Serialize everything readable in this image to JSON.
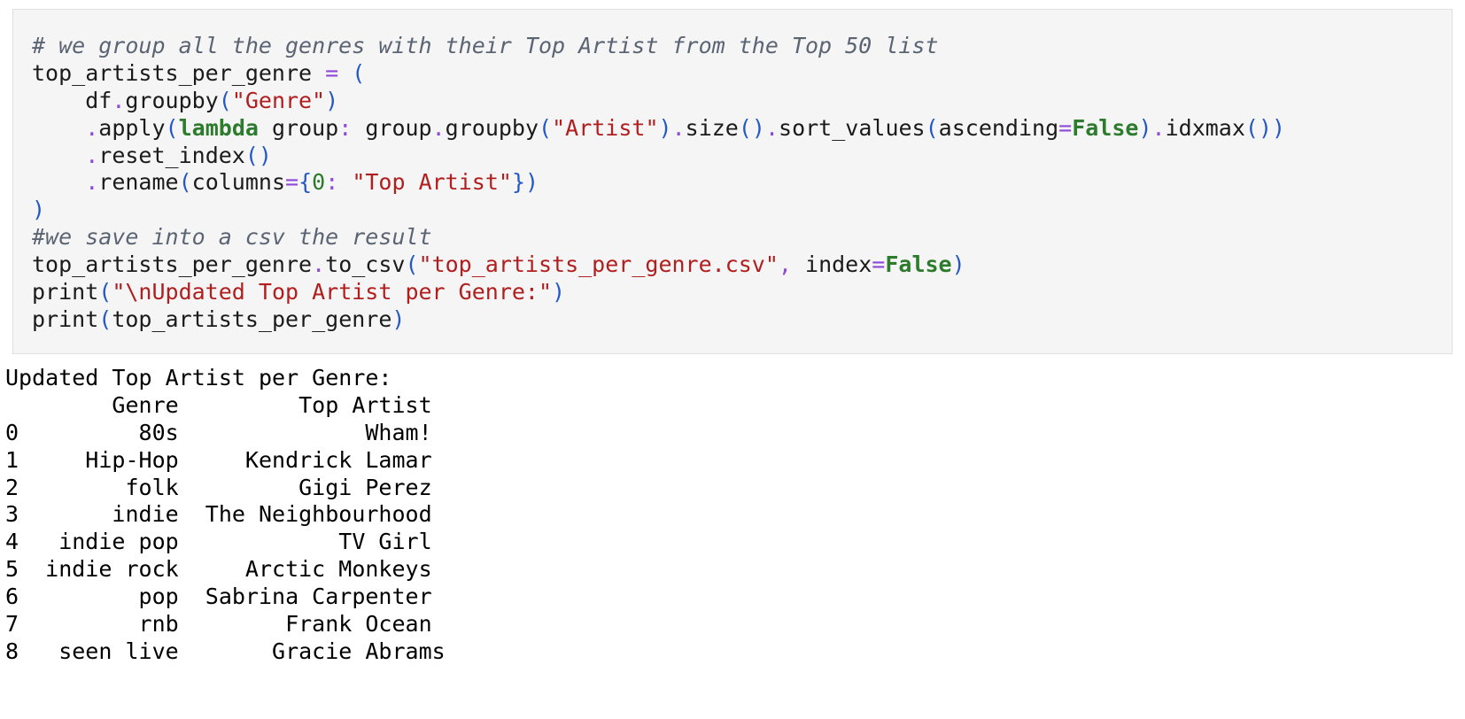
{
  "code_cell": {
    "lines": [
      [
        {
          "t": "# we group all the genres with their Top Artist from the Top 50 list",
          "k": "cm"
        }
      ],
      [
        {
          "t": "top_artists_per_genre ",
          "k": "tx"
        },
        {
          "t": "=",
          "k": "op"
        },
        {
          "t": " ",
          "k": "tx"
        },
        {
          "t": "(",
          "k": "br"
        }
      ],
      [
        {
          "t": "    df",
          "k": "tx"
        },
        {
          "t": ".",
          "k": "op"
        },
        {
          "t": "groupby",
          "k": "tx"
        },
        {
          "t": "(",
          "k": "br"
        },
        {
          "t": "\"Genre\"",
          "k": "str"
        },
        {
          "t": ")",
          "k": "br"
        }
      ],
      [
        {
          "t": "    ",
          "k": "tx"
        },
        {
          "t": ".",
          "k": "op"
        },
        {
          "t": "apply",
          "k": "tx"
        },
        {
          "t": "(",
          "k": "br"
        },
        {
          "t": "lambda",
          "k": "kw"
        },
        {
          "t": " group",
          "k": "tx"
        },
        {
          "t": ":",
          "k": "op"
        },
        {
          "t": " group",
          "k": "tx"
        },
        {
          "t": ".",
          "k": "op"
        },
        {
          "t": "groupby",
          "k": "tx"
        },
        {
          "t": "(",
          "k": "br"
        },
        {
          "t": "\"Artist\"",
          "k": "str"
        },
        {
          "t": ")",
          "k": "br"
        },
        {
          "t": ".",
          "k": "op"
        },
        {
          "t": "size",
          "k": "tx"
        },
        {
          "t": "()",
          "k": "br"
        },
        {
          "t": ".",
          "k": "op"
        },
        {
          "t": "sort_values",
          "k": "tx"
        },
        {
          "t": "(",
          "k": "br"
        },
        {
          "t": "ascending",
          "k": "tx"
        },
        {
          "t": "=",
          "k": "op"
        },
        {
          "t": "False",
          "k": "kw"
        },
        {
          "t": ")",
          "k": "br"
        },
        {
          "t": ".",
          "k": "op"
        },
        {
          "t": "idxmax",
          "k": "tx"
        },
        {
          "t": "())",
          "k": "br"
        }
      ],
      [
        {
          "t": "    ",
          "k": "tx"
        },
        {
          "t": ".",
          "k": "op"
        },
        {
          "t": "reset_index",
          "k": "tx"
        },
        {
          "t": "()",
          "k": "br"
        }
      ],
      [
        {
          "t": "    ",
          "k": "tx"
        },
        {
          "t": ".",
          "k": "op"
        },
        {
          "t": "rename",
          "k": "tx"
        },
        {
          "t": "(",
          "k": "br"
        },
        {
          "t": "columns",
          "k": "tx"
        },
        {
          "t": "=",
          "k": "op"
        },
        {
          "t": "{",
          "k": "br"
        },
        {
          "t": "0",
          "k": "num"
        },
        {
          "t": ":",
          "k": "op"
        },
        {
          "t": " ",
          "k": "tx"
        },
        {
          "t": "\"Top Artist\"",
          "k": "str"
        },
        {
          "t": "})",
          "k": "br"
        }
      ],
      [
        {
          "t": ")",
          "k": "br"
        }
      ],
      [
        {
          "t": "#we save into a csv the result",
          "k": "cm"
        }
      ],
      [
        {
          "t": "top_artists_per_genre",
          "k": "tx"
        },
        {
          "t": ".",
          "k": "op"
        },
        {
          "t": "to_csv",
          "k": "tx"
        },
        {
          "t": "(",
          "k": "br"
        },
        {
          "t": "\"top_artists_per_genre.csv\"",
          "k": "str"
        },
        {
          "t": ",",
          "k": "op"
        },
        {
          "t": " index",
          "k": "tx"
        },
        {
          "t": "=",
          "k": "op"
        },
        {
          "t": "False",
          "k": "kw"
        },
        {
          "t": ")",
          "k": "br"
        }
      ],
      [
        {
          "t": "print",
          "k": "tx"
        },
        {
          "t": "(",
          "k": "br"
        },
        {
          "t": "\"\\nUpdated Top Artist per Genre:\"",
          "k": "str"
        },
        {
          "t": ")",
          "k": "br"
        }
      ],
      [
        {
          "t": "print",
          "k": "tx"
        },
        {
          "t": "(",
          "k": "br"
        },
        {
          "t": "top_artists_per_genre",
          "k": "tx"
        },
        {
          "t": ")",
          "k": "br"
        }
      ]
    ]
  },
  "output": {
    "lines": [
      "Updated Top Artist per Genre:",
      "        Genre         Top Artist",
      "0         80s              Wham!",
      "1     Hip-Hop     Kendrick Lamar",
      "2        folk         Gigi Perez",
      "3       indie  The Neighbourhood",
      "4   indie pop            TV Girl",
      "5  indie rock     Arctic Monkeys",
      "6         pop  Sabrina Carpenter",
      "7         rnb        Frank Ocean",
      "8   seen live       Gracie Abrams"
    ]
  }
}
